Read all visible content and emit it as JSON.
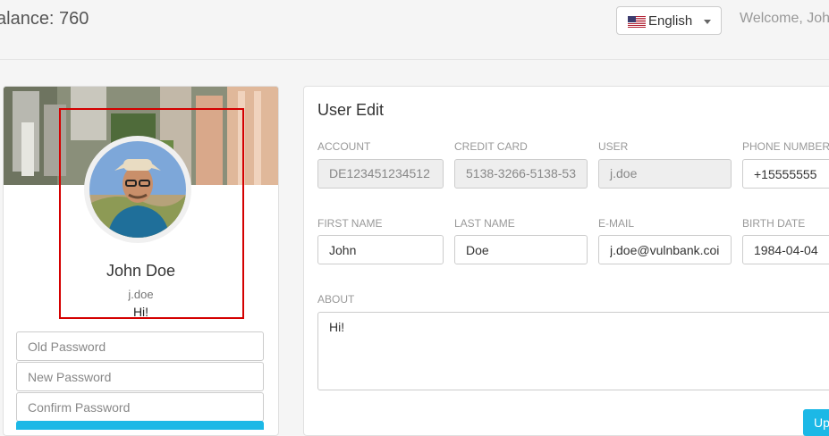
{
  "header": {
    "balance_text": "alance: 760",
    "language": {
      "selected": "English",
      "flag_icon": "us-flag-icon"
    },
    "welcome_text": "Welcome, Joh"
  },
  "profile": {
    "full_name": "John Doe",
    "username": "j.doe",
    "about_short": "Hi!",
    "password_form": {
      "old_placeholder": "Old Password",
      "new_placeholder": "New Password",
      "confirm_placeholder": "Confirm Password"
    }
  },
  "user_edit": {
    "title": "User Edit",
    "fields": {
      "account": {
        "label": "ACCOUNT",
        "value": "DE123451234512"
      },
      "credit_card": {
        "label": "CREDIT CARD",
        "value": "5138-3266-5138-53"
      },
      "user": {
        "label": "USER",
        "value": "j.doe"
      },
      "phone": {
        "label": "PHONE NUMBER",
        "value": "+15555555"
      },
      "first_name": {
        "label": "FIRST NAME",
        "value": "John"
      },
      "last_name": {
        "label": "LAST NAME",
        "value": "Doe"
      },
      "email": {
        "label": "E-MAIL",
        "value": "j.doe@vulnbank.coi"
      },
      "birth_date": {
        "label": "BIRTH DATE",
        "value": "1984-04-04"
      },
      "about": {
        "label": "ABOUT",
        "value": "Hi!"
      }
    },
    "update_button_label": "Up"
  },
  "colors": {
    "accent": "#1cb8e6",
    "highlight": "#d40000"
  }
}
